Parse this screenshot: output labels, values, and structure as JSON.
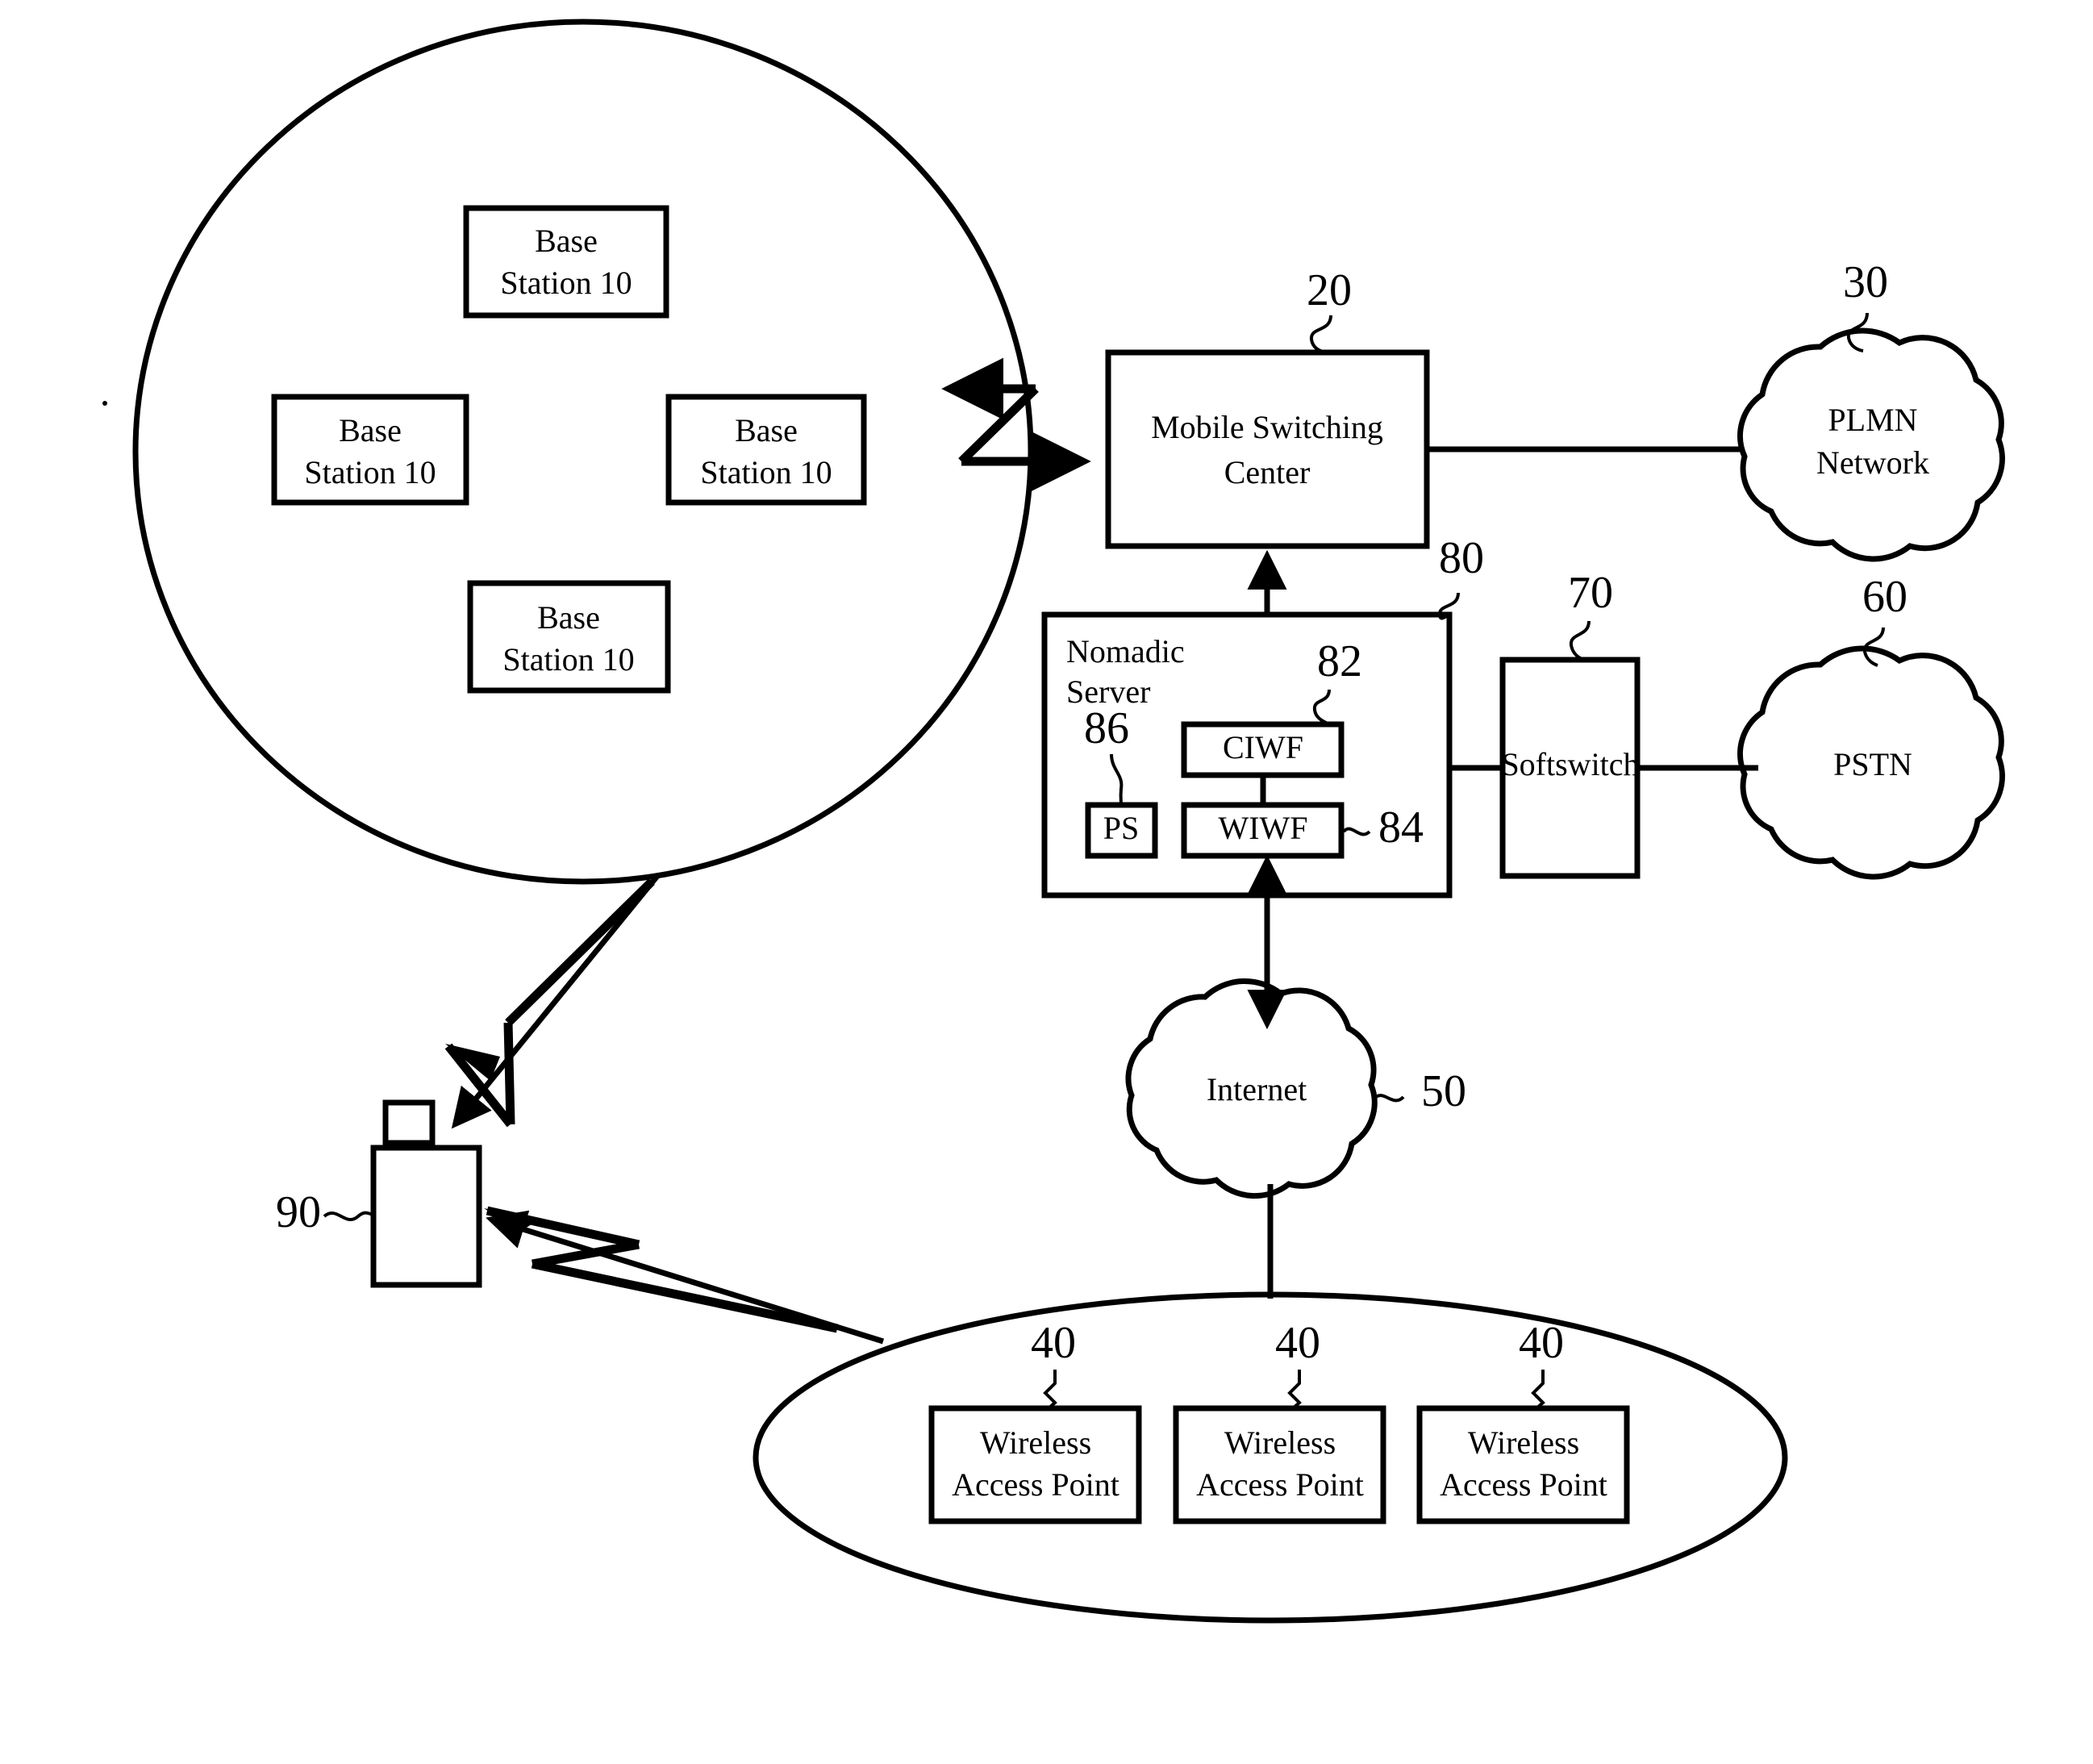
{
  "figure": {
    "type": "patent-network-diagram",
    "background_color": "#ffffff",
    "line_color": "#000000"
  },
  "cellular_region": {
    "name": "cellular-coverage-ellipse",
    "base_stations": [
      {
        "line1": "Base",
        "line2": "Station 10"
      },
      {
        "line1": "Base",
        "line2": "Station 10"
      },
      {
        "line1": "Base",
        "line2": "Station 10"
      },
      {
        "line1": "Base",
        "line2": "Station 10"
      }
    ]
  },
  "nodes": {
    "mobile_switching_center": {
      "line1": "Mobile Switching",
      "line2": "Center",
      "ref": "20"
    },
    "plmn_network": {
      "line1": "PLMN",
      "line2": "Network",
      "ref": "30"
    },
    "nomadic_server": {
      "line1": "Nomadic",
      "line2": "Server",
      "ref": "80",
      "components": [
        {
          "label": "CIWF",
          "ref": "82"
        },
        {
          "label": "WIWF",
          "ref": "84"
        },
        {
          "label": "PS",
          "ref": "86"
        }
      ]
    },
    "softswitch": {
      "label": "Softswitch",
      "ref": "70"
    },
    "pstn": {
      "label": "PSTN",
      "ref": "60"
    },
    "internet": {
      "label": "Internet",
      "ref": "50"
    },
    "mobile_device": {
      "ref": "90"
    }
  },
  "wlan_region": {
    "name": "wlan-coverage-ellipse",
    "access_points": [
      {
        "line1": "Wireless",
        "line2": "Access Point",
        "ref": "40"
      },
      {
        "line1": "Wireless",
        "line2": "Access Point",
        "ref": "40"
      },
      {
        "line1": "Wireless",
        "line2": "Access Point",
        "ref": "40"
      }
    ]
  }
}
